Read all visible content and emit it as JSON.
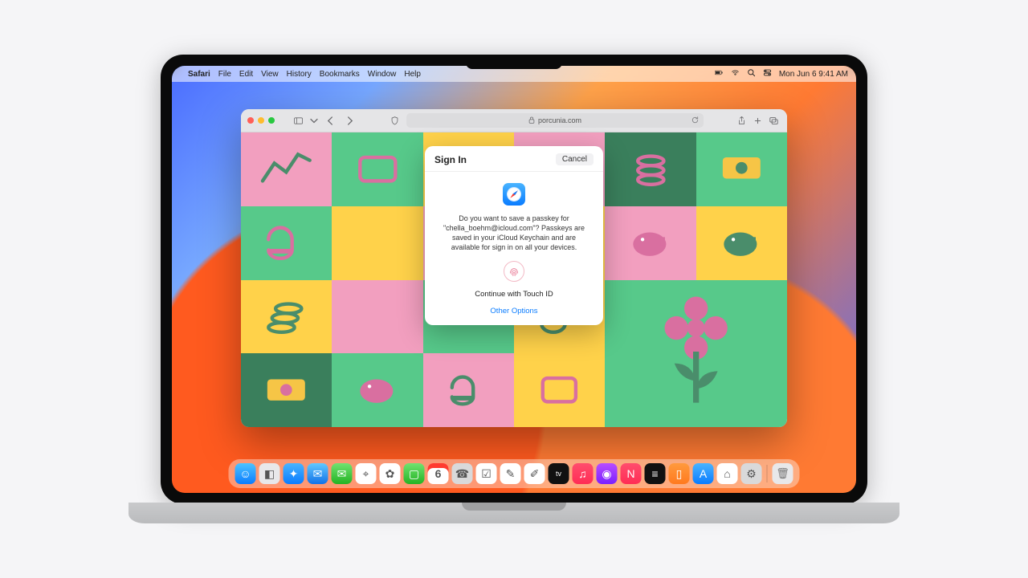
{
  "menubar": {
    "apple": "",
    "app": "Safari",
    "items": [
      "File",
      "Edit",
      "View",
      "History",
      "Bookmarks",
      "Window",
      "Help"
    ],
    "status": {
      "battery": "battery-icon",
      "wifi": "wifi-icon",
      "search": "search-icon",
      "control": "control-center-icon"
    },
    "datetime": "Mon Jun 6  9:41 AM"
  },
  "safari": {
    "address_lock": "􀎡",
    "address": "porcunia.com"
  },
  "dialog": {
    "title": "Sign In",
    "cancel": "Cancel",
    "message": "Do you want to save a passkey for \"chella_boehm@icloud.com\"? Passkeys are saved in your iCloud Keychain and are available for sign in on all your devices.",
    "continue": "Continue with Touch ID",
    "other": "Other Options"
  },
  "dock": {
    "apps": [
      {
        "name": "finder",
        "bg": "linear-gradient(#4dc3ff,#0a7cff)",
        "glyph": "☺"
      },
      {
        "name": "launchpad",
        "bg": "#e8e8ea",
        "glyph": "◧"
      },
      {
        "name": "safari",
        "bg": "linear-gradient(#49b4ff,#0a7cff)",
        "glyph": "✦"
      },
      {
        "name": "mail",
        "bg": "linear-gradient(#62c8ff,#1272e8)",
        "glyph": "✉"
      },
      {
        "name": "messages",
        "bg": "linear-gradient(#70e370,#24b324)",
        "glyph": "✉"
      },
      {
        "name": "maps",
        "bg": "#fff",
        "glyph": "⌖"
      },
      {
        "name": "photos",
        "bg": "#fff",
        "glyph": "✿"
      },
      {
        "name": "facetime",
        "bg": "linear-gradient(#70e370,#24b324)",
        "glyph": "▢"
      },
      {
        "name": "calendar",
        "bg": "#fff",
        "glyph": "6"
      },
      {
        "name": "contacts",
        "bg": "#d9d9da",
        "glyph": "☎"
      },
      {
        "name": "reminders",
        "bg": "#fff",
        "glyph": "☑"
      },
      {
        "name": "notes",
        "bg": "#fff",
        "glyph": "✎"
      },
      {
        "name": "freeform",
        "bg": "#fff",
        "glyph": "✐"
      },
      {
        "name": "tv",
        "bg": "#111",
        "glyph": "tv"
      },
      {
        "name": "music",
        "bg": "linear-gradient(#ff4d6d,#ff2d55)",
        "glyph": "♫"
      },
      {
        "name": "podcasts",
        "bg": "linear-gradient(#b84dff,#7a1fff)",
        "glyph": "◉"
      },
      {
        "name": "news",
        "bg": "linear-gradient(#ff4d6d,#ff2d55)",
        "glyph": "N"
      },
      {
        "name": "stocks",
        "bg": "#111",
        "glyph": "≡"
      },
      {
        "name": "books",
        "bg": "linear-gradient(#ff9a3d,#ff7a1f)",
        "glyph": "▯"
      },
      {
        "name": "appstore",
        "bg": "linear-gradient(#49b4ff,#0a7cff)",
        "glyph": "A"
      },
      {
        "name": "home",
        "bg": "#fff",
        "glyph": "⌂"
      },
      {
        "name": "settings",
        "bg": "#d9d9da",
        "glyph": "⚙"
      }
    ],
    "trash": "trash"
  }
}
